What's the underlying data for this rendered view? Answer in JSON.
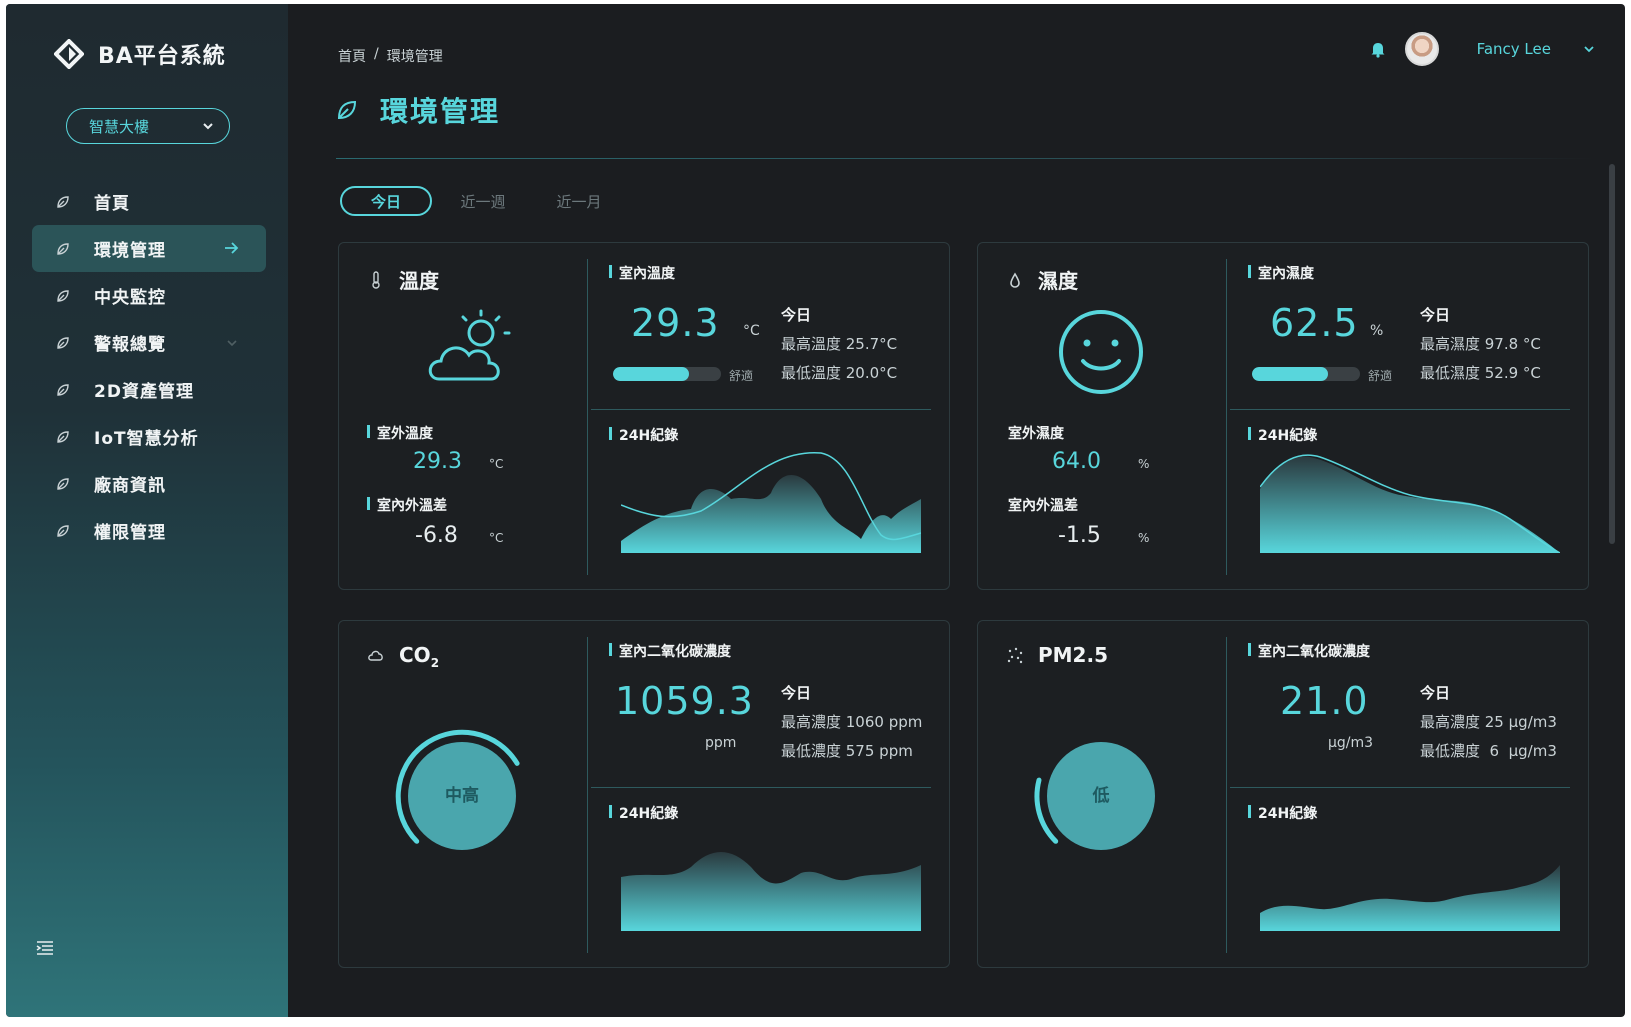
{
  "app": {
    "name": "BA平台系統",
    "building": "智慧大樓"
  },
  "nav": [
    {
      "label": "首頁",
      "icon": "leaf-icon"
    },
    {
      "label": "環境管理",
      "icon": "leaf-icon",
      "active": true
    },
    {
      "label": "中央監控",
      "icon": "leaf-icon"
    },
    {
      "label": "警報總覽",
      "icon": "leaf-icon",
      "expandable": true
    },
    {
      "label": "2D資產管理",
      "icon": "leaf-icon"
    },
    {
      "label": "IoT智慧分析",
      "icon": "leaf-icon"
    },
    {
      "label": "廠商資訊",
      "icon": "leaf-icon"
    },
    {
      "label": "權限管理",
      "icon": "leaf-icon"
    }
  ],
  "breadcrumb": {
    "home": "首頁",
    "sep": "/",
    "current": "環境管理"
  },
  "page": {
    "title": "環境管理"
  },
  "user": {
    "name": "Fancy Lee"
  },
  "tabs": [
    "今日",
    "近一週",
    "近一月"
  ],
  "colors": {
    "accent": "#58d6dc",
    "background": "#1b1d20"
  },
  "cards": {
    "temperature": {
      "title": "溫度",
      "indoor_label": "室內溫度",
      "value": "29.3",
      "unit": "°C",
      "comfort_label": "舒適",
      "comfort_level": 0.7,
      "today_label": "今日",
      "max": "最高溫度 25.7°C",
      "min": "最低溫度 20.0°C",
      "outdoor_label": "室外溫度",
      "outdoor_value": "29.3",
      "outdoor_unit": "°C",
      "diff_label": "室內外溫差",
      "diff_value": "-6.8",
      "diff_unit": "°C",
      "history_label": "24H紀錄"
    },
    "humidity": {
      "title": "濕度",
      "indoor_label": "室內濕度",
      "value": "62.5",
      "unit": "%",
      "comfort_label": "舒適",
      "comfort_level": 0.7,
      "today_label": "今日",
      "max": "最高濕度 97.8 °C",
      "min": "最低濕度 52.9 °C",
      "outdoor_label": "室外濕度",
      "outdoor_value": "64.0",
      "outdoor_unit": "%",
      "diff_label": "室內外溫差",
      "diff_value": "-1.5",
      "diff_unit": "%",
      "history_label": "24H紀錄"
    },
    "co2": {
      "title": "CO",
      "title_sub": "2",
      "indoor_label": "室內二氧化碳濃度",
      "value": "1059.3",
      "unit": "ppm",
      "today_label": "今日",
      "max": "最高濃度 1060 ppm",
      "min": "最低濃度 575 ppm",
      "level": "中高",
      "level_fraction": 0.72,
      "history_label": "24H紀錄"
    },
    "pm25": {
      "title": "PM2.5",
      "indoor_label": "室內二氧化碳濃度",
      "value": "21.0",
      "unit": "μg/m3",
      "today_label": "今日",
      "max": "最高濃度 25 μg/m3",
      "min": "最低濃度  6  μg/m3",
      "level": "低",
      "level_fraction": 0.22,
      "history_label": "24H紀錄"
    }
  }
}
